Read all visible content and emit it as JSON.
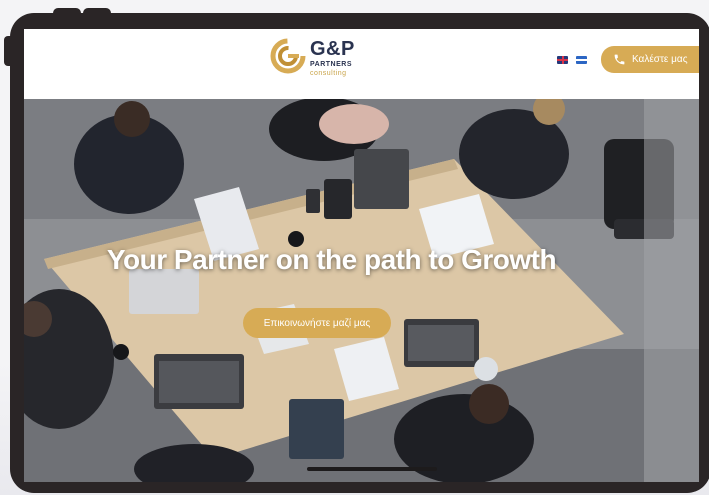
{
  "brand": {
    "name": "G&P",
    "line2": "PARTNERS",
    "line3": "consulting",
    "colors": {
      "navy": "#2a3350",
      "gold": "#d7ab55"
    }
  },
  "header": {
    "languages": [
      "en-flag",
      "gr-flag"
    ],
    "call_button": {
      "icon": "phone-icon",
      "label": "Καλέστε μας"
    }
  },
  "hero": {
    "title": "Your Partner on the path to Growth",
    "cta_label": "Επικοινωνήστε μαζί μας",
    "background": "meeting-photo"
  }
}
